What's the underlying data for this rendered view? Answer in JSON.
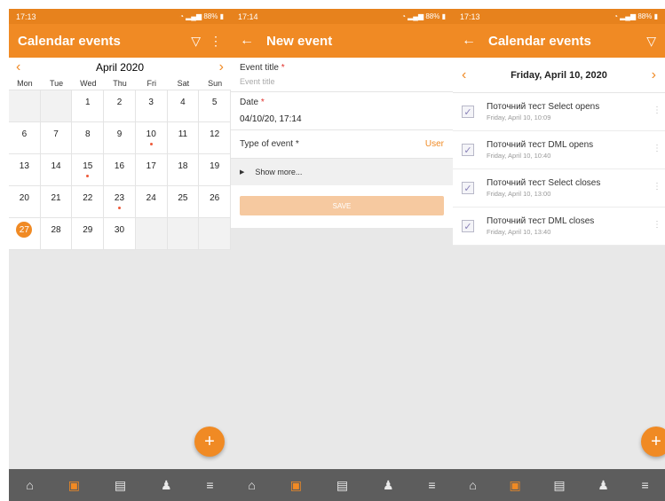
{
  "screen1": {
    "status": {
      "time": "17:13",
      "right": "88%"
    },
    "title": "Calendar events",
    "month_label": "April 2020",
    "weekdays": [
      "Mon",
      "Tue",
      "Wed",
      "Thu",
      "Fri",
      "Sat",
      "Sun"
    ],
    "days": [
      {
        "n": "",
        "empty": true
      },
      {
        "n": "",
        "empty": true
      },
      {
        "n": "1"
      },
      {
        "n": "2"
      },
      {
        "n": "3"
      },
      {
        "n": "4"
      },
      {
        "n": "5"
      },
      {
        "n": "6"
      },
      {
        "n": "7"
      },
      {
        "n": "8"
      },
      {
        "n": "9"
      },
      {
        "n": "10",
        "dot": true
      },
      {
        "n": "11"
      },
      {
        "n": "12"
      },
      {
        "n": "13"
      },
      {
        "n": "14"
      },
      {
        "n": "15",
        "dot": true
      },
      {
        "n": "16"
      },
      {
        "n": "17"
      },
      {
        "n": "18"
      },
      {
        "n": "19"
      },
      {
        "n": "20"
      },
      {
        "n": "21"
      },
      {
        "n": "22"
      },
      {
        "n": "23",
        "dot": true
      },
      {
        "n": "24"
      },
      {
        "n": "25"
      },
      {
        "n": "26"
      },
      {
        "n": "27",
        "today": true
      },
      {
        "n": "28"
      },
      {
        "n": "29"
      },
      {
        "n": "30"
      },
      {
        "n": "",
        "empty": true
      },
      {
        "n": "",
        "empty": true
      },
      {
        "n": "",
        "empty": true
      }
    ],
    "fab": "+"
  },
  "screen2": {
    "status": {
      "time": "17:14",
      "right": "88%"
    },
    "title": "New event",
    "event_title_label": "Event title",
    "event_title_placeholder": "Event title",
    "date_label": "Date",
    "date_value": "04/10/20, 17:14",
    "type_label": "Type of event",
    "type_value": "User",
    "show_more": "Show more...",
    "save": "SAVE",
    "required_mark": "*"
  },
  "screen3": {
    "status": {
      "time": "17:13",
      "right": "88%"
    },
    "title": "Calendar events",
    "day_label": "Friday, April 10, 2020",
    "events": [
      {
        "title": "Поточний тест Select opens",
        "time": "Friday, April 10, 10:09"
      },
      {
        "title": "Поточний тест DML opens",
        "time": "Friday, April 10, 10:40"
      },
      {
        "title": "Поточний тест Select closes",
        "time": "Friday, April 10, 13:00"
      },
      {
        "title": "Поточний тест DML closes",
        "time": "Friday, April 10, 13:40"
      }
    ],
    "fab": "+"
  },
  "nav_icons": [
    "home-icon",
    "calendar-icon",
    "chat-icon",
    "bell-icon",
    "menu-icon"
  ],
  "colors": {
    "accent": "#f08a24",
    "status_bar": "#e7821d",
    "nav_bar": "#5d5d5d",
    "event_dot": "#ee5a3a"
  }
}
